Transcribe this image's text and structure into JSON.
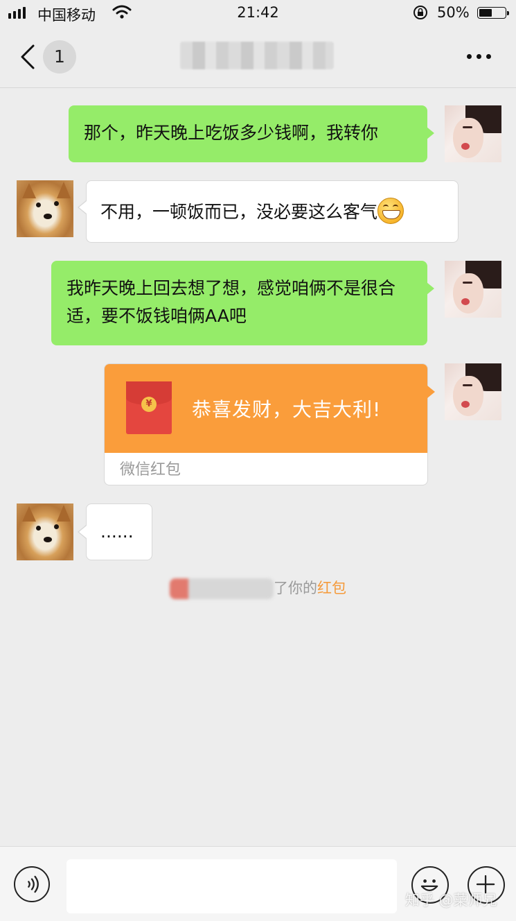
{
  "status_bar": {
    "carrier": "中国移动",
    "time": "21:42",
    "battery_percent": "50%",
    "battery_level": 0.5
  },
  "nav": {
    "unread_count": "1"
  },
  "messages": [
    {
      "side": "right",
      "type": "text",
      "text": "那个，昨天晚上吃饭多少钱啊，我转你"
    },
    {
      "side": "left",
      "type": "text",
      "text": "不用，一顿饭而已，没必要这么客气",
      "emoji": "grinning-face"
    },
    {
      "side": "right",
      "type": "text",
      "text": "我昨天晚上回去想了想，感觉咱俩不是很合适，要不饭钱咱俩AA吧"
    },
    {
      "side": "right",
      "type": "red_packet",
      "greeting": "恭喜发财，大吉大利!",
      "label": "微信红包",
      "coin": "¥"
    },
    {
      "side": "left",
      "type": "text",
      "text": "......"
    }
  ],
  "system_message": {
    "suffix": "了你的",
    "link": "红包"
  },
  "watermark": "知乎 @菜师兄",
  "colors": {
    "background": "#ededed",
    "outgoing_bubble": "#95ec69",
    "red_packet": "#fa9d3b",
    "link": "#f59a3a"
  }
}
